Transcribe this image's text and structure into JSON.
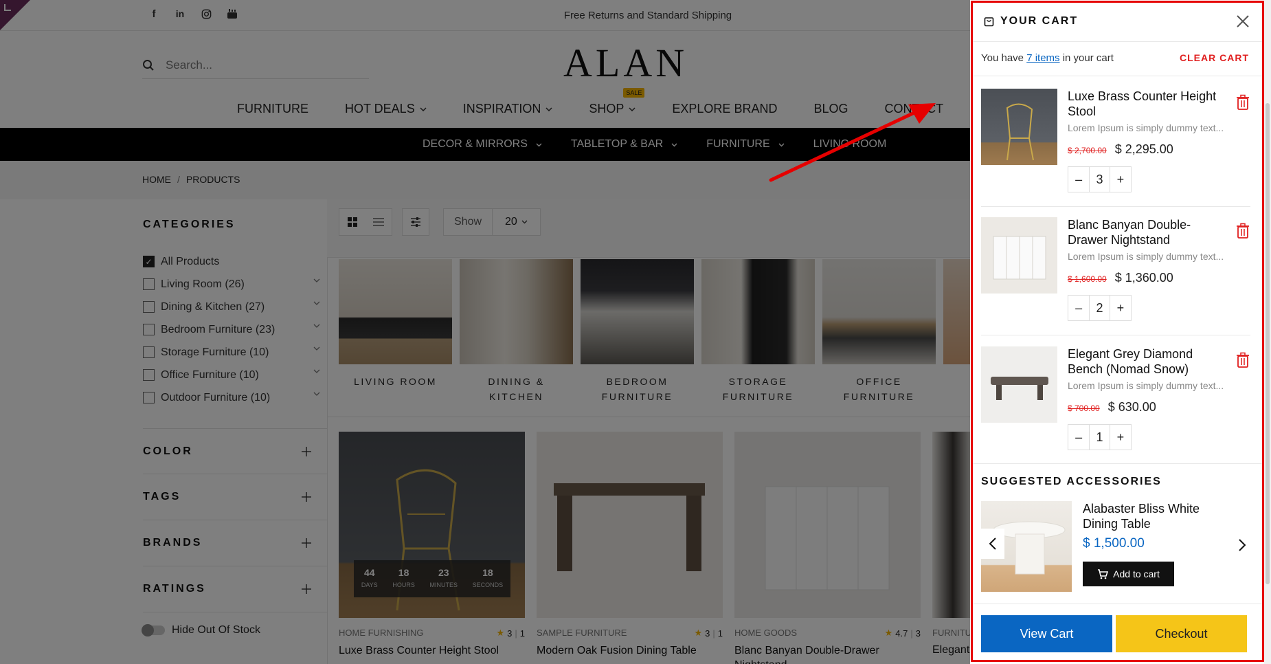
{
  "topbar": {
    "promo": "Free Returns and Standard Shipping",
    "social_icons": [
      "facebook-icon",
      "linkedin-icon",
      "instagram-icon",
      "youtube-icon"
    ]
  },
  "header": {
    "search_placeholder": "Search...",
    "logo": "ALAN"
  },
  "main_nav": {
    "items": [
      "FURNITURE",
      "HOT DEALS",
      "INSPIRATION",
      "SHOP",
      "EXPLORE BRAND",
      "BLOG",
      "CONTACT"
    ],
    "sale_badge": "SALE"
  },
  "sub_nav": {
    "items": [
      "DECOR & MIRRORS",
      "TABLETOP & BAR",
      "FURNITURE",
      "LIVING ROOM"
    ]
  },
  "breadcrumb": {
    "home": "HOME",
    "separator": "/",
    "current": "PRODUCTS"
  },
  "sidebar": {
    "categories_heading": "CATEGORIES",
    "categories": [
      {
        "label": "All Products",
        "checked": true
      },
      {
        "label": "Living Room (26)",
        "checked": false
      },
      {
        "label": "Dining & Kitchen (27)",
        "checked": false
      },
      {
        "label": "Bedroom Furniture (23)",
        "checked": false
      },
      {
        "label": "Storage Furniture (10)",
        "checked": false
      },
      {
        "label": "Office Furniture (10)",
        "checked": false
      },
      {
        "label": "Outdoor Furniture (10)",
        "checked": false
      }
    ],
    "facets": [
      "COLOR",
      "TAGS",
      "BRANDS",
      "RATINGS"
    ],
    "hide_out_of_stock": "Hide Out Of Stock"
  },
  "toolbar": {
    "show_label": "Show",
    "show_value": "20"
  },
  "category_tiles": [
    {
      "label": "LIVING ROOM"
    },
    {
      "label": "DINING & KITCHEN"
    },
    {
      "label": "BEDROOM FURNITURE"
    },
    {
      "label": "STORAGE FURNITURE"
    },
    {
      "label": "OFFICE FURNITURE"
    }
  ],
  "products": [
    {
      "category": "HOME FURNISHING",
      "rating": "3",
      "reviews": "1",
      "name": "Luxe Brass Counter Height Stool",
      "countdown": {
        "days": "44",
        "days_label": "DAYS",
        "hours": "18",
        "hours_label": "HOURS",
        "minutes": "23",
        "minutes_label": "MINUTES",
        "seconds": "18",
        "seconds_label": "SECONDS"
      }
    },
    {
      "category": "SAMPLE FURNITURE",
      "rating": "3",
      "reviews": "1",
      "name": "Modern Oak Fusion Dining Table"
    },
    {
      "category": "HOME GOODS",
      "rating": "4.7",
      "reviews": "3",
      "name": "Blanc Banyan Double-Drawer Nightstand"
    },
    {
      "category": "FURNITU",
      "rating": "",
      "reviews": "",
      "name": "Elegant"
    }
  ],
  "cart": {
    "title": "YOUR CART",
    "summary_prefix": "You have",
    "summary_count": "7 items",
    "summary_suffix": "in your cart",
    "clear_label": "CLEAR CART",
    "items": [
      {
        "name": "Luxe Brass Counter Height Stool",
        "desc": "Lorem Ipsum is simply dummy text...",
        "old_price": "$ 2,700.00",
        "price": "$ 2,295.00",
        "qty": "3"
      },
      {
        "name": "Blanc Banyan Double-Drawer Nightstand",
        "desc": "Lorem Ipsum is simply dummy text...",
        "old_price": "$ 1,600.00",
        "price": "$ 1,360.00",
        "qty": "2"
      },
      {
        "name": "Elegant Grey Diamond Bench (Nomad Snow)",
        "desc": "Lorem Ipsum is simply dummy text...",
        "old_price": "$ 700.00",
        "price": "$ 630.00",
        "qty": "1"
      }
    ],
    "qty_minus": "–",
    "qty_plus": "+",
    "suggested_heading": "SUGGESTED ACCESSORIES",
    "suggested": {
      "name": "Alabaster Bliss White Dining Table",
      "price": "$ 1,500.00",
      "button": "Add to cart"
    },
    "view_cart": "View Cart",
    "checkout": "Checkout"
  },
  "colors": {
    "accent_blue": "#0a66c2",
    "checkout_yellow": "#f5c518",
    "highlight_red": "#e60000",
    "clear_red": "#e01f1f"
  }
}
